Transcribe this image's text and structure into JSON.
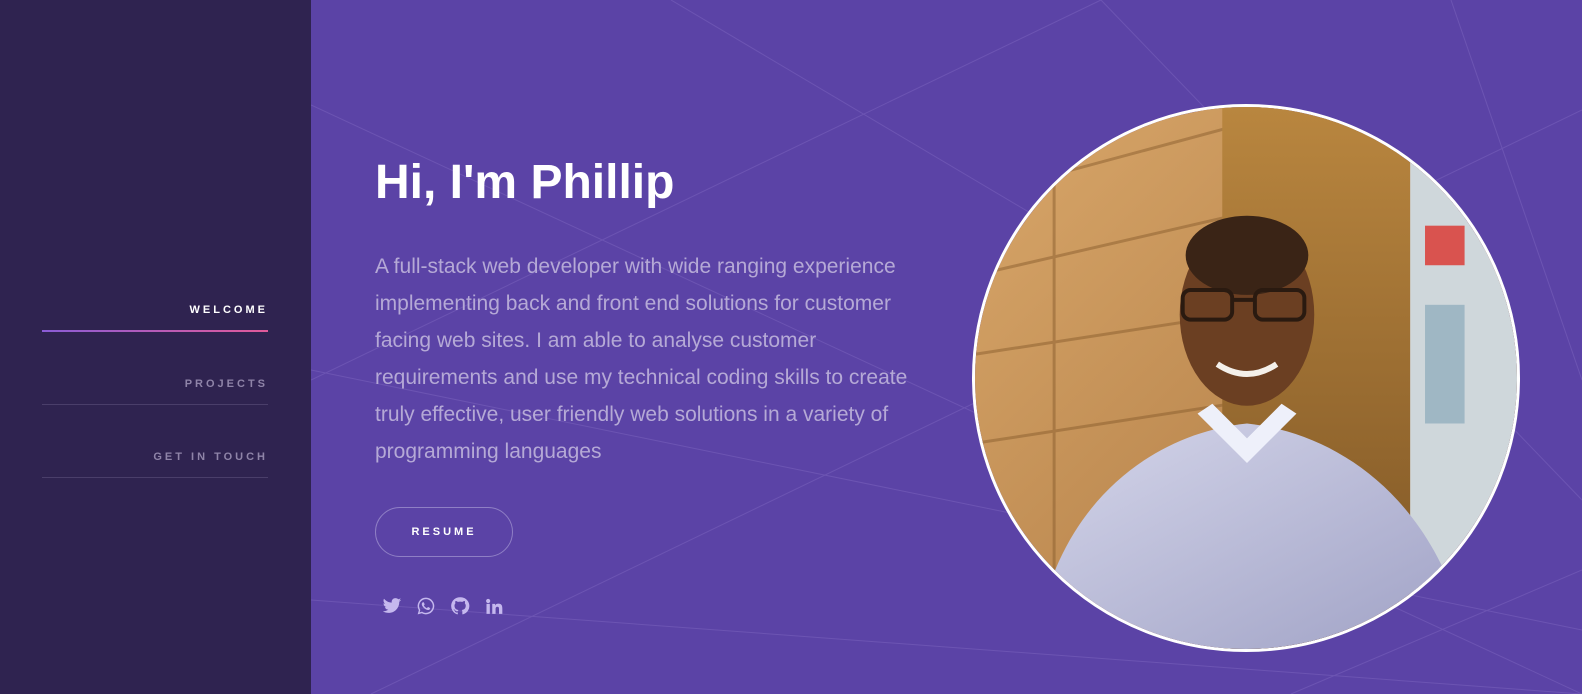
{
  "nav": {
    "items": [
      {
        "label": "WELCOME",
        "active": true
      },
      {
        "label": "PROJECTS",
        "active": false
      },
      {
        "label": "GET IN TOUCH",
        "active": false
      }
    ]
  },
  "hero": {
    "title": "Hi, I'm Phillip",
    "description": "A full-stack web developer with wide ranging experience implementing back and front end solutions for customer facing web sites. I am able to analyse customer requirements and use my technical coding skills to create truly effective, user friendly web solutions in a variety of programming languages",
    "resume_label": "RESUME"
  },
  "socials": [
    "twitter-icon",
    "whatsapp-icon",
    "github-icon",
    "linkedin-icon"
  ],
  "colors": {
    "main_bg": "#5b43a6",
    "sidebar_bg": "#2f2350",
    "accent_gradient_start": "#8a5cd6",
    "accent_gradient_end": "#e25a9a"
  }
}
